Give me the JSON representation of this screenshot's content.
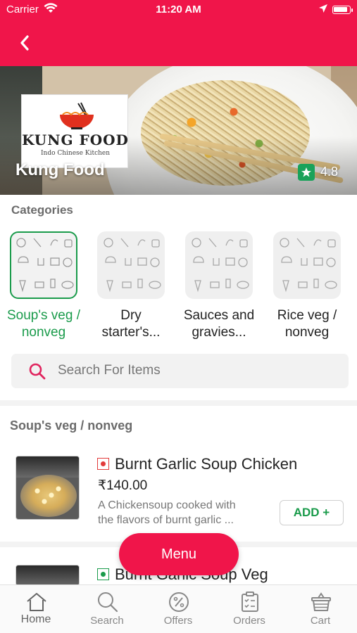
{
  "status_bar": {
    "carrier": "Carrier",
    "time": "11:20 AM"
  },
  "theme": {
    "primary": "#f0154a",
    "accent_green": "#1a9b4b",
    "nonveg_red": "#e23b3b"
  },
  "restaurant": {
    "name": "Kung Food",
    "rating": "4.8",
    "logo_title": "KUNG FOOD",
    "logo_subtitle": "Indo Chinese Kitchen"
  },
  "categories": {
    "title": "Categories",
    "items": [
      {
        "line1": "Soup's veg /",
        "line2": "nonveg",
        "selected": true
      },
      {
        "line1": "Dry",
        "line2": "starter's...",
        "selected": false
      },
      {
        "line1": "Sauces and",
        "line2": "gravies...",
        "selected": false
      },
      {
        "line1": "Rice veg /",
        "line2": "nonveg",
        "selected": false
      }
    ]
  },
  "search": {
    "placeholder": "Search For Items"
  },
  "section": {
    "title": "Soup's veg / nonveg"
  },
  "items": [
    {
      "name": "Burnt Garlic Soup Chicken",
      "price": "₹140.00",
      "desc_line1": "A Chickensoup cooked with",
      "desc_line2": "the flavors of burnt garlic ...",
      "type": "nonveg",
      "add_label": "ADD +"
    },
    {
      "name": "Burnt Garlic Soup Veg",
      "type": "veg"
    }
  ],
  "menu_button": "Menu",
  "tabs": [
    {
      "label": "Home",
      "icon": "home-icon",
      "active": true
    },
    {
      "label": "Search",
      "icon": "search-icon",
      "active": false
    },
    {
      "label": "Offers",
      "icon": "offers-icon",
      "active": false
    },
    {
      "label": "Orders",
      "icon": "orders-icon",
      "active": false
    },
    {
      "label": "Cart",
      "icon": "cart-icon",
      "active": false
    }
  ]
}
